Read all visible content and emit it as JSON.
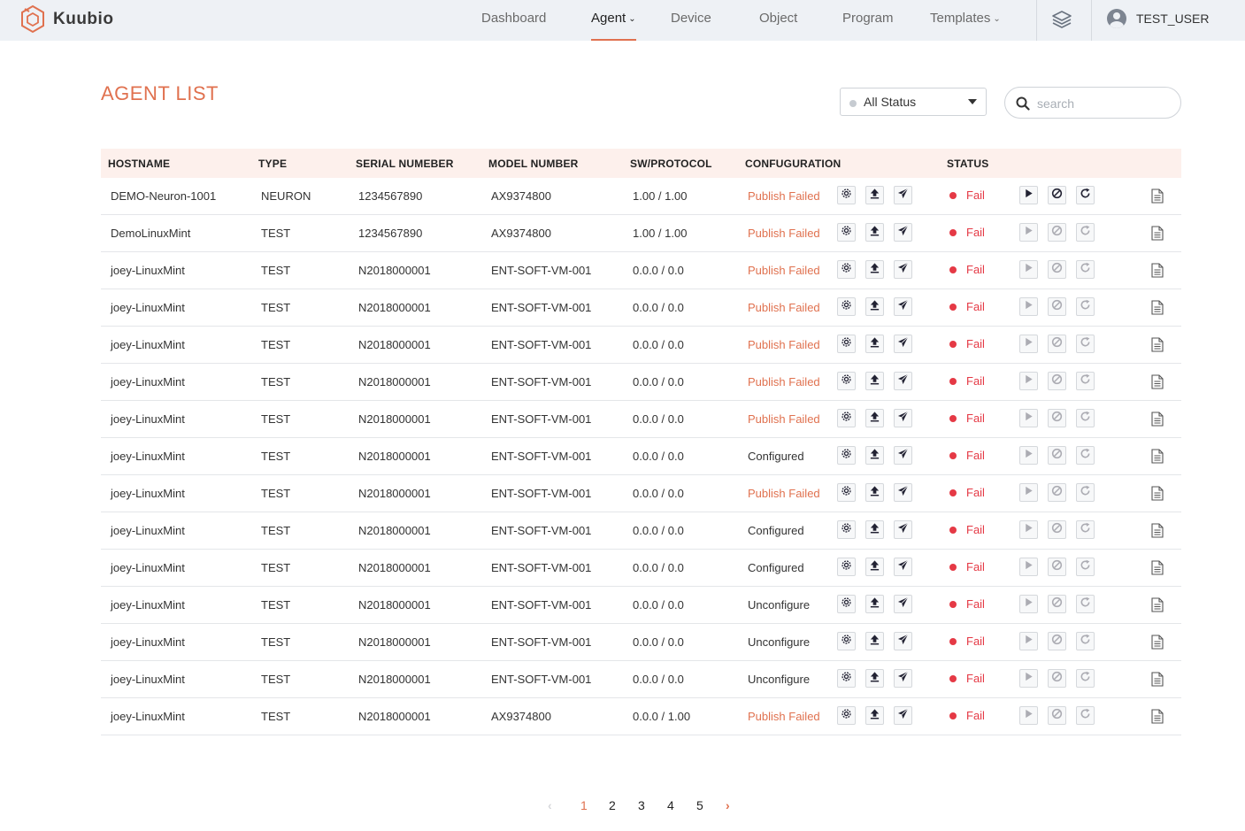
{
  "brand": {
    "name": "Kuubio",
    "accent": "#e0714f"
  },
  "nav": {
    "items": [
      {
        "label": "Dashboard",
        "active": false,
        "dropdown": false
      },
      {
        "label": "Agent",
        "active": true,
        "dropdown": true
      },
      {
        "label": "Device",
        "active": false,
        "dropdown": false
      },
      {
        "label": "Object",
        "active": false,
        "dropdown": false
      },
      {
        "label": "Program",
        "active": false,
        "dropdown": false
      },
      {
        "label": "Templates",
        "active": false,
        "dropdown": true
      }
    ],
    "layers_icon": "layers-icon",
    "user": "TEST_USER"
  },
  "page": {
    "title": "AGENT LIST",
    "status_filter": "All Status",
    "search_placeholder": "search"
  },
  "table": {
    "headers": {
      "hostname": "HOSTNAME",
      "type": "TYPE",
      "serial": "SERIAL NUMEBER",
      "model": "MODEL NUMBER",
      "sw": "SW/PROTOCOL",
      "config": "CONFUGURATION",
      "status": "STATUS"
    },
    "rows": [
      {
        "hostname": "DEMO-Neuron-1001",
        "type": "NEURON",
        "serial": "1234567890",
        "model": "AX9374800",
        "sw": "1.00 / 1.00",
        "config": "Publish Failed",
        "status": "Fail",
        "controls_enabled": true
      },
      {
        "hostname": "DemoLinuxMint",
        "type": "TEST",
        "serial": "1234567890",
        "model": "AX9374800",
        "sw": "1.00 / 1.00",
        "config": "Publish Failed",
        "status": "Fail",
        "controls_enabled": false
      },
      {
        "hostname": "joey-LinuxMint",
        "type": "TEST",
        "serial": "N2018000001",
        "model": "ENT-SOFT-VM-001",
        "sw": "0.0.0 / 0.0",
        "config": "Publish Failed",
        "status": "Fail",
        "controls_enabled": false
      },
      {
        "hostname": "joey-LinuxMint",
        "type": "TEST",
        "serial": "N2018000001",
        "model": "ENT-SOFT-VM-001",
        "sw": "0.0.0 / 0.0",
        "config": "Publish Failed",
        "status": "Fail",
        "controls_enabled": false
      },
      {
        "hostname": "joey-LinuxMint",
        "type": "TEST",
        "serial": "N2018000001",
        "model": "ENT-SOFT-VM-001",
        "sw": "0.0.0 / 0.0",
        "config": "Publish Failed",
        "status": "Fail",
        "controls_enabled": false
      },
      {
        "hostname": "joey-LinuxMint",
        "type": "TEST",
        "serial": "N2018000001",
        "model": "ENT-SOFT-VM-001",
        "sw": "0.0.0 / 0.0",
        "config": "Publish Failed",
        "status": "Fail",
        "controls_enabled": false
      },
      {
        "hostname": "joey-LinuxMint",
        "type": "TEST",
        "serial": "N2018000001",
        "model": "ENT-SOFT-VM-001",
        "sw": "0.0.0 / 0.0",
        "config": "Publish Failed",
        "status": "Fail",
        "controls_enabled": false
      },
      {
        "hostname": "joey-LinuxMint",
        "type": "TEST",
        "serial": "N2018000001",
        "model": "ENT-SOFT-VM-001",
        "sw": "0.0.0 / 0.0",
        "config": "Configured",
        "status": "Fail",
        "controls_enabled": false
      },
      {
        "hostname": "joey-LinuxMint",
        "type": "TEST",
        "serial": "N2018000001",
        "model": "ENT-SOFT-VM-001",
        "sw": "0.0.0 / 0.0",
        "config": "Publish Failed",
        "status": "Fail",
        "controls_enabled": false
      },
      {
        "hostname": "joey-LinuxMint",
        "type": "TEST",
        "serial": "N2018000001",
        "model": "ENT-SOFT-VM-001",
        "sw": "0.0.0 / 0.0",
        "config": "Configured",
        "status": "Fail",
        "controls_enabled": false
      },
      {
        "hostname": "joey-LinuxMint",
        "type": "TEST",
        "serial": "N2018000001",
        "model": "ENT-SOFT-VM-001",
        "sw": "0.0.0 / 0.0",
        "config": "Configured",
        "status": "Fail",
        "controls_enabled": false
      },
      {
        "hostname": "joey-LinuxMint",
        "type": "TEST",
        "serial": "N2018000001",
        "model": "ENT-SOFT-VM-001",
        "sw": "0.0.0 / 0.0",
        "config": "Unconfigure",
        "status": "Fail",
        "controls_enabled": false
      },
      {
        "hostname": "joey-LinuxMint",
        "type": "TEST",
        "serial": "N2018000001",
        "model": "ENT-SOFT-VM-001",
        "sw": "0.0.0 / 0.0",
        "config": "Unconfigure",
        "status": "Fail",
        "controls_enabled": false
      },
      {
        "hostname": "joey-LinuxMint",
        "type": "TEST",
        "serial": "N2018000001",
        "model": "ENT-SOFT-VM-001",
        "sw": "0.0.0 / 0.0",
        "config": "Unconfigure",
        "status": "Fail",
        "controls_enabled": false
      },
      {
        "hostname": "joey-LinuxMint",
        "type": "TEST",
        "serial": "N2018000001",
        "model": "AX9374800",
        "sw": "0.0.0 / 1.00",
        "config": "Publish Failed",
        "status": "Fail",
        "controls_enabled": false
      }
    ]
  },
  "pagination": {
    "pages": [
      "1",
      "2",
      "3",
      "4",
      "5"
    ],
    "current": "1",
    "prev": "‹",
    "next": "›"
  },
  "colors": {
    "fail": "#e53945",
    "header_bg": "#fdf0ec",
    "topbar_bg": "#eef1f5"
  }
}
